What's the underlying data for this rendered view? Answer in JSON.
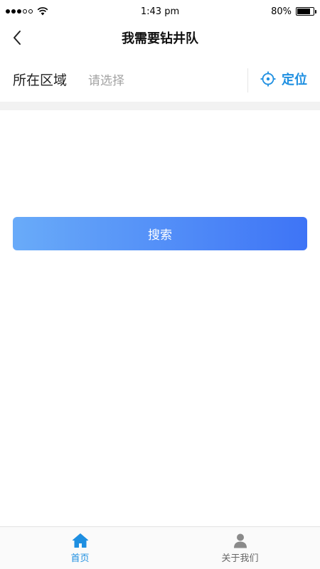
{
  "status_bar": {
    "time": "1:43 pm",
    "battery": "80%",
    "battery_level": 0.8
  },
  "nav": {
    "title": "我需要钻井队",
    "back_icon": "chevron-left-icon"
  },
  "region": {
    "label": "所在区域",
    "placeholder": "请选择",
    "locate_label": "定位",
    "locate_icon": "crosshair-icon"
  },
  "search": {
    "label": "搜索"
  },
  "tabs": [
    {
      "label": "首页",
      "icon": "home-icon",
      "active": true
    },
    {
      "label": "关于我们",
      "icon": "person-icon",
      "active": false
    }
  ],
  "colors": {
    "accent": "#1e8fe1",
    "button_start": "#69abf9",
    "button_end": "#3e74f6"
  }
}
